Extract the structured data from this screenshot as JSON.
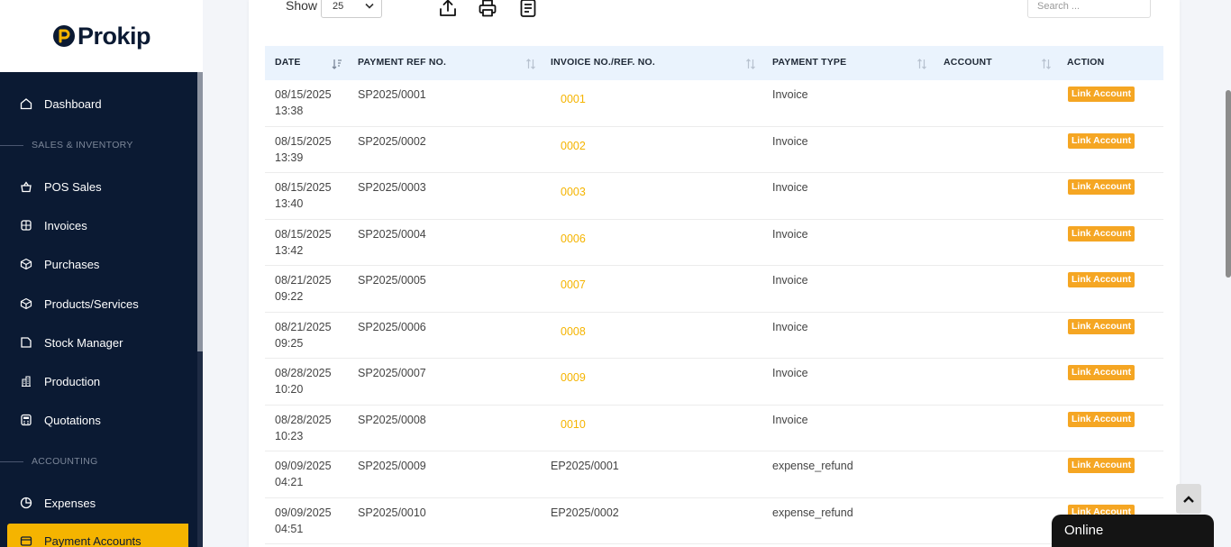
{
  "brand": {
    "name": "Prokip"
  },
  "sidebar": {
    "items": [
      {
        "label": "Dashboard",
        "icon": "home-icon"
      },
      {
        "label": "POS Sales",
        "icon": "basket-icon"
      },
      {
        "label": "Invoices",
        "icon": "invoice-icon"
      },
      {
        "label": "Purchases",
        "icon": "purchases-icon"
      },
      {
        "label": "Products/Services",
        "icon": "box-icon"
      },
      {
        "label": "Stock Manager",
        "icon": "folder-icon"
      },
      {
        "label": "Production",
        "icon": "building-icon"
      },
      {
        "label": "Quotations",
        "icon": "calculator-icon"
      },
      {
        "label": "Expenses",
        "icon": "pie-chart-icon"
      },
      {
        "label": "Payment Accounts",
        "icon": "wallet-icon"
      }
    ],
    "sections": [
      "SALES & INVENTORY",
      "ACCOUNTING"
    ]
  },
  "toolbar": {
    "show_label": "Show",
    "page_size": "25",
    "search_placeholder": "Search ..."
  },
  "table": {
    "headers": [
      "DATE",
      "PAYMENT REF NO.",
      "INVOICE NO./REF. NO.",
      "PAYMENT TYPE",
      "ACCOUNT",
      "ACTION"
    ],
    "rows": [
      {
        "date": "08/15/2025",
        "time": "13:38",
        "ref": "SP2025/0001",
        "invoice": "0001",
        "invoice_is_link": true,
        "type": "Invoice",
        "account": "",
        "action": "Link Account"
      },
      {
        "date": "08/15/2025",
        "time": "13:39",
        "ref": "SP2025/0002",
        "invoice": "0002",
        "invoice_is_link": true,
        "type": "Invoice",
        "account": "",
        "action": "Link Account"
      },
      {
        "date": "08/15/2025",
        "time": "13:40",
        "ref": "SP2025/0003",
        "invoice": "0003",
        "invoice_is_link": true,
        "type": "Invoice",
        "account": "",
        "action": "Link Account"
      },
      {
        "date": "08/15/2025",
        "time": "13:42",
        "ref": "SP2025/0004",
        "invoice": "0006",
        "invoice_is_link": true,
        "type": "Invoice",
        "account": "",
        "action": "Link Account"
      },
      {
        "date": "08/21/2025",
        "time": "09:22",
        "ref": "SP2025/0005",
        "invoice": "0007",
        "invoice_is_link": true,
        "type": "Invoice",
        "account": "",
        "action": "Link Account"
      },
      {
        "date": "08/21/2025",
        "time": "09:25",
        "ref": "SP2025/0006",
        "invoice": "0008",
        "invoice_is_link": true,
        "type": "Invoice",
        "account": "",
        "action": "Link Account"
      },
      {
        "date": "08/28/2025",
        "time": "10:20",
        "ref": "SP2025/0007",
        "invoice": "0009",
        "invoice_is_link": true,
        "type": "Invoice",
        "account": "",
        "action": "Link Account"
      },
      {
        "date": "08/28/2025",
        "time": "10:23",
        "ref": "SP2025/0008",
        "invoice": "0010",
        "invoice_is_link": true,
        "type": "Invoice",
        "account": "",
        "action": "Link Account"
      },
      {
        "date": "09/09/2025",
        "time": "04:21",
        "ref": "SP2025/0009",
        "invoice": "EP2025/0001",
        "invoice_is_link": false,
        "type": "expense_refund",
        "account": "",
        "action": "Link Account"
      },
      {
        "date": "09/09/2025",
        "time": "04:51",
        "ref": "SP2025/0010",
        "invoice": "EP2025/0002",
        "invoice_is_link": false,
        "type": "expense_refund",
        "account": "",
        "action": "Link Account"
      }
    ]
  },
  "chat": {
    "label": "Online"
  },
  "colors": {
    "accent": "#f5b400",
    "sidebar_bg": "#0b1a33",
    "action_button": "#f5a623",
    "header_bg": "#eaf3fd"
  }
}
